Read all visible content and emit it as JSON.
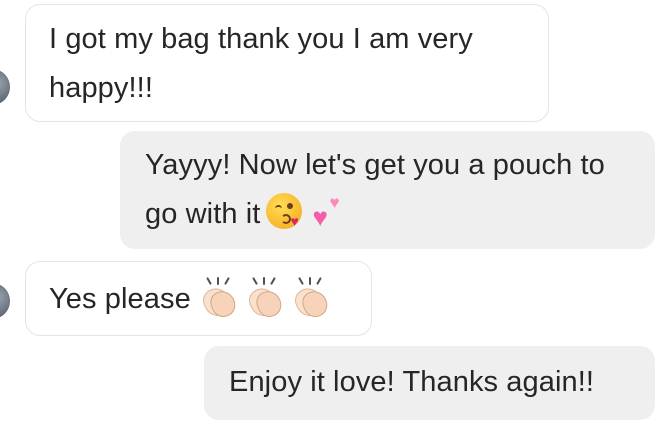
{
  "messages": [
    {
      "direction": "incoming",
      "text": "I got my bag thank you I am very happy!!!"
    },
    {
      "direction": "outgoing",
      "text": "Yayyy! Now let's get you a pouch to go with it",
      "emojis": [
        "face-throwing-kiss-emoji",
        "two-hearts-emoji"
      ]
    },
    {
      "direction": "incoming",
      "text": "Yes please",
      "emojis": [
        "clapping-hands-emoji",
        "clapping-hands-emoji",
        "clapping-hands-emoji"
      ]
    },
    {
      "direction": "outgoing",
      "text": "Enjoy it love! Thanks again!!"
    }
  ],
  "colors": {
    "incoming_bubble": "#ffffff",
    "incoming_border": "#e4e4e4",
    "outgoing_bubble": "#efefef",
    "text": "#262626"
  }
}
